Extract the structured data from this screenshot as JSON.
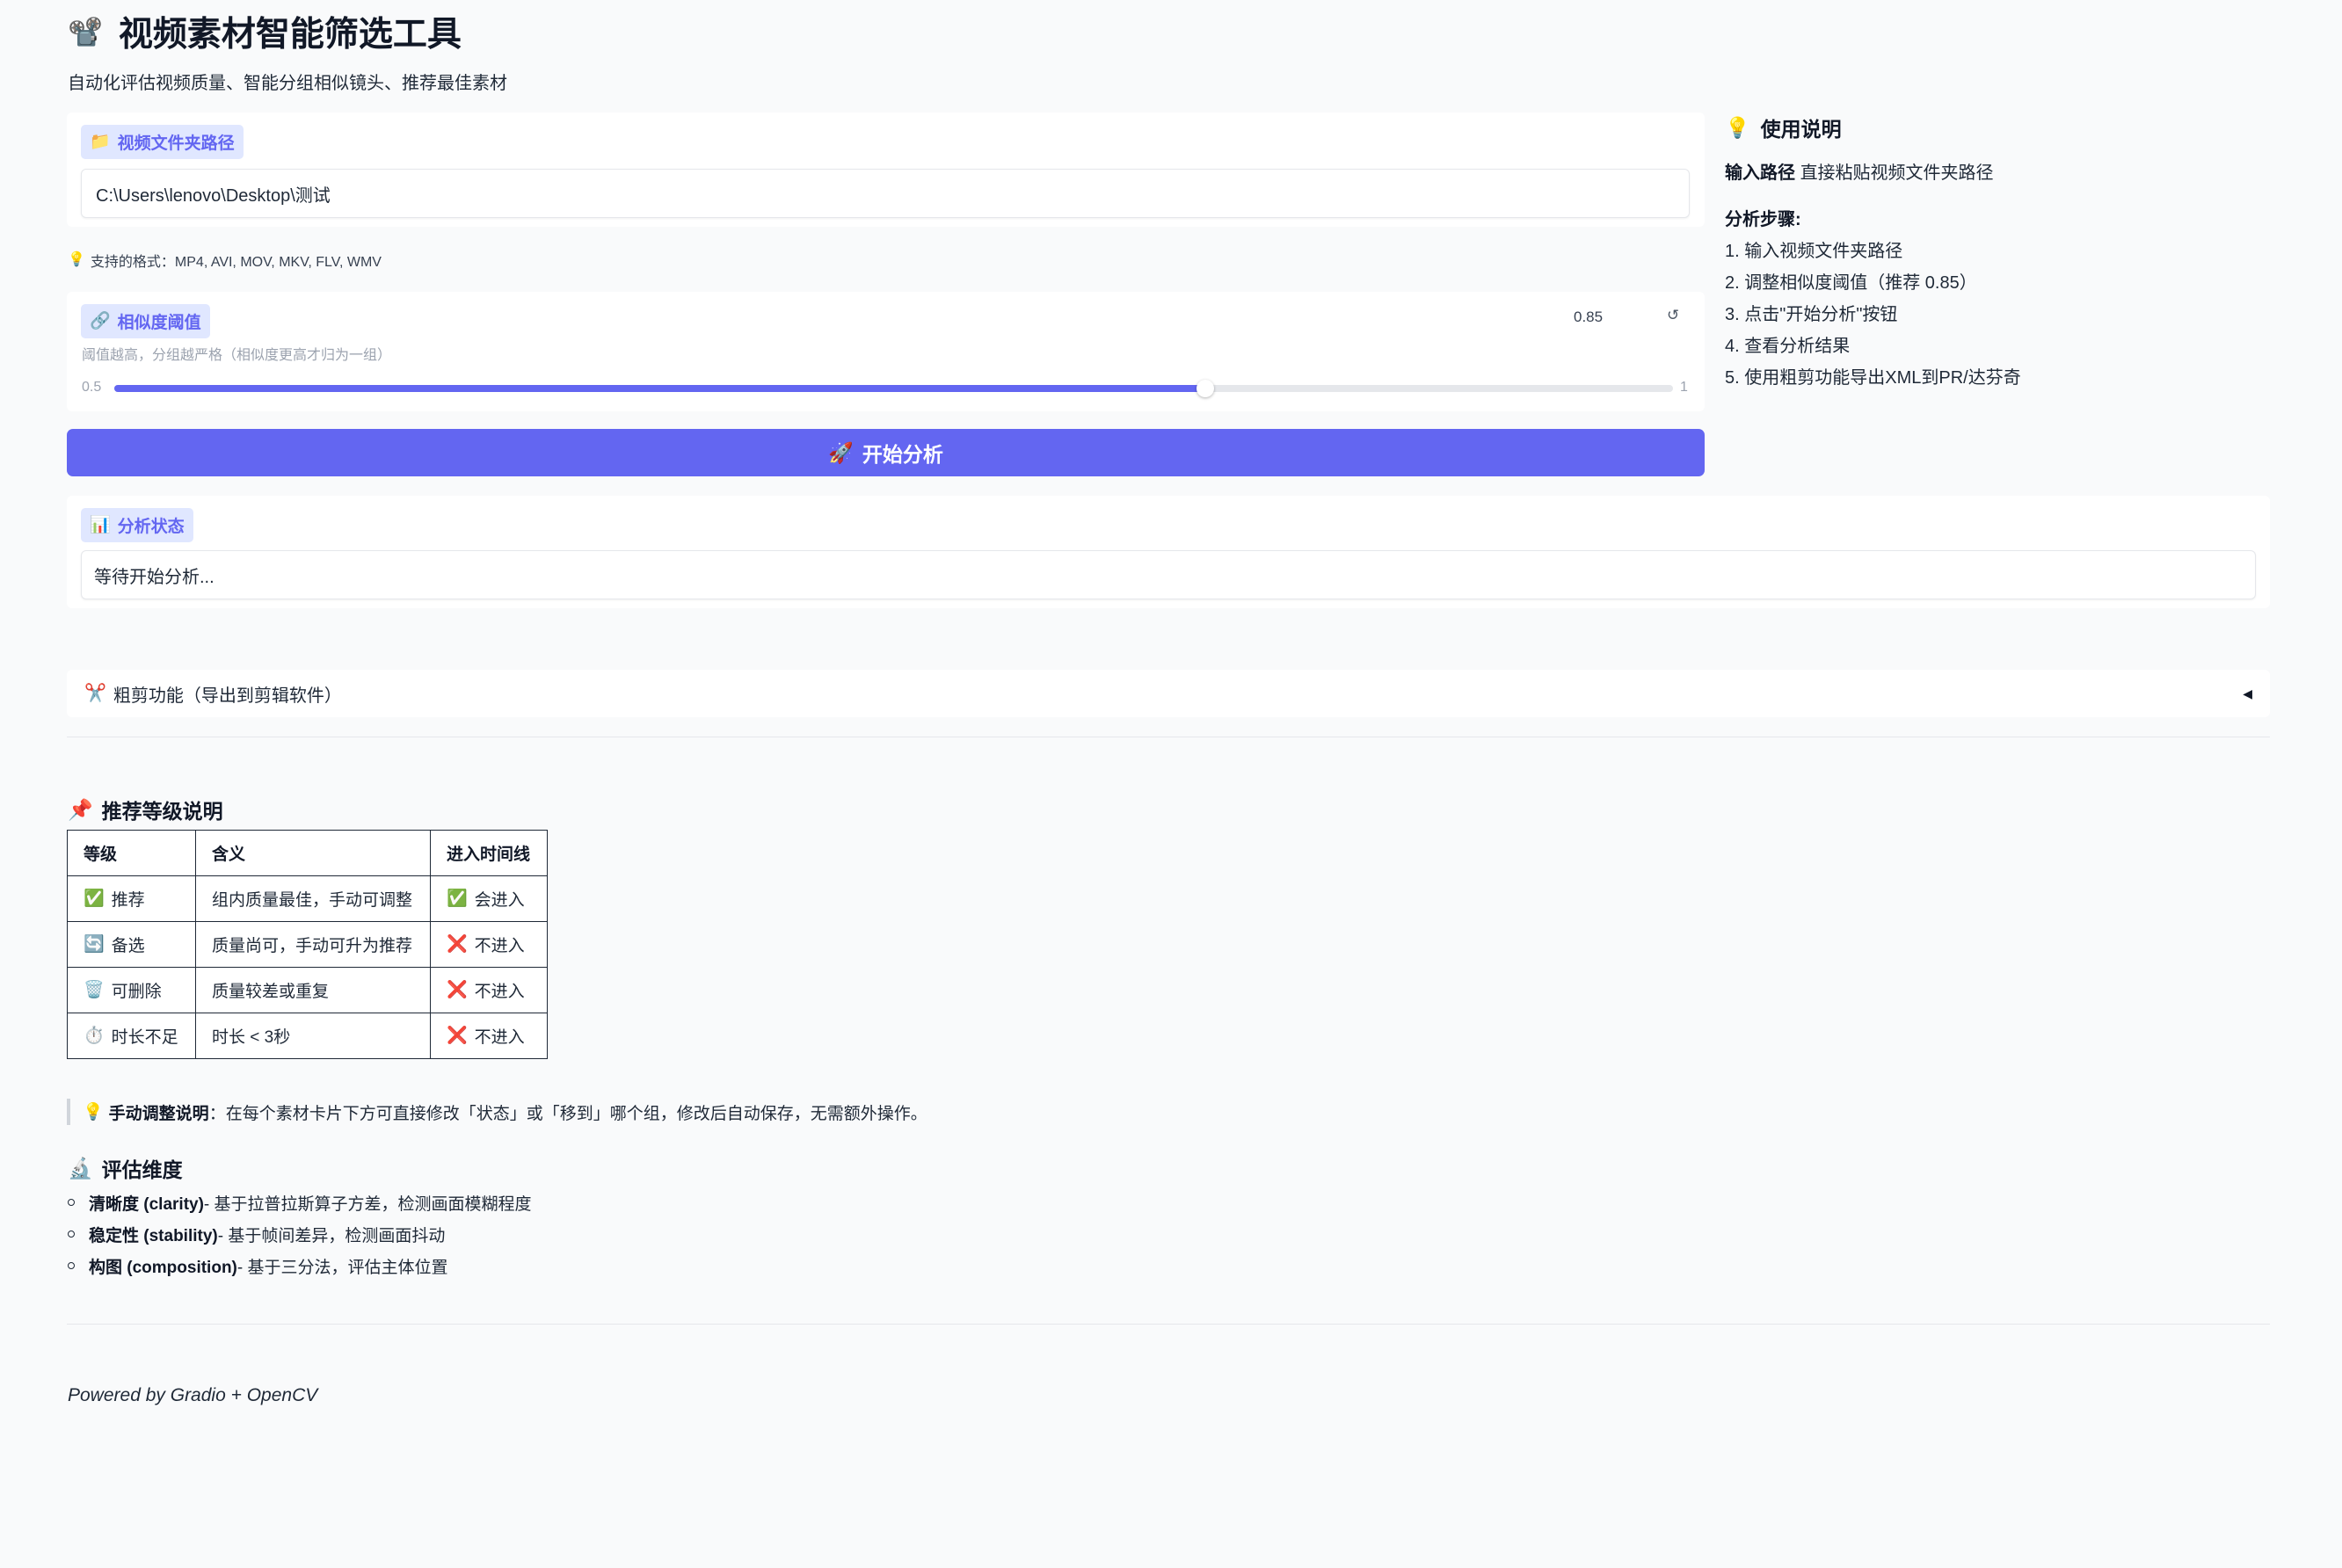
{
  "header": {
    "icon": "📽️",
    "title": "视频素材智能筛选工具",
    "subtitle": "自动化评估视频质量、智能分组相似镜头、推荐最佳素材"
  },
  "folder": {
    "icon": "📁",
    "label": "视频文件夹路径",
    "value": "C:\\Users\\lenovo\\Desktop\\测试"
  },
  "formats": {
    "icon": "💡",
    "text": "支持的格式：MP4, AVI, MOV, MKV, FLV, WMV"
  },
  "similarity": {
    "icon": "🔗",
    "label": "相似度阈值",
    "info": "阈值越高，分组越严格（相似度更高才归为一组）",
    "value": "0.85",
    "value_num": 0.85,
    "min": "0.5",
    "min_num": 0.5,
    "max": "1",
    "max_num": 1,
    "reset_icon": "↺"
  },
  "start_button": {
    "icon": "🚀",
    "label": "开始分析"
  },
  "status": {
    "icon": "📊",
    "label": "分析状态",
    "value": "等待开始分析..."
  },
  "usage": {
    "icon": "💡",
    "title": "使用说明",
    "input_path_bold": "输入路径",
    "input_path_text": "直接粘贴视频文件夹路径",
    "steps_title": "分析步骤:",
    "steps": [
      "1. 输入视频文件夹路径",
      "2. 调整相似度阈值（推荐 0.85）",
      "3. 点击\"开始分析\"按钮",
      "4. 查看分析结果",
      "5. 使用粗剪功能导出XML到PR/达芬奇"
    ]
  },
  "rough_cut": {
    "icon": "✂️",
    "label": "粗剪功能（导出到剪辑软件）",
    "chevron": "◀"
  },
  "grades": {
    "icon": "📌",
    "title": "推荐等级说明",
    "headers": [
      "等级",
      "含义",
      "进入时间线"
    ],
    "rows": [
      {
        "icon": "✅",
        "grade": "推荐",
        "meaning": "组内质量最佳，手动可调整",
        "tl_icon": "✅",
        "timeline": "会进入"
      },
      {
        "icon": "🔄",
        "grade": "备选",
        "meaning": "质量尚可，手动可升为推荐",
        "tl_icon": "❌",
        "timeline": "不进入"
      },
      {
        "icon": "🗑️",
        "grade": "可删除",
        "meaning": "质量较差或重复",
        "tl_icon": "❌",
        "timeline": "不进入"
      },
      {
        "icon": "⏱️",
        "grade": "时长不足",
        "meaning": "时长 < 3秒",
        "tl_icon": "❌",
        "timeline": "不进入"
      }
    ]
  },
  "manual_note": {
    "icon": "💡",
    "bold": "手动调整说明",
    "text": "：在每个素材卡片下方可直接修改「状态」或「移到」哪个组，修改后自动保存，无需额外操作。"
  },
  "dimensions": {
    "icon": "🔬",
    "title": "评估维度",
    "items": [
      {
        "bold": "清晰度 (clarity)",
        "text": " - 基于拉普拉斯算子方差，检测画面模糊程度"
      },
      {
        "bold": "稳定性 (stability)",
        "text": " - 基于帧间差异，检测画面抖动"
      },
      {
        "bold": "构图 (composition)",
        "text": " - 基于三分法，评估主体位置"
      }
    ]
  },
  "footer": {
    "text": "Powered by Gradio + OpenCV"
  }
}
